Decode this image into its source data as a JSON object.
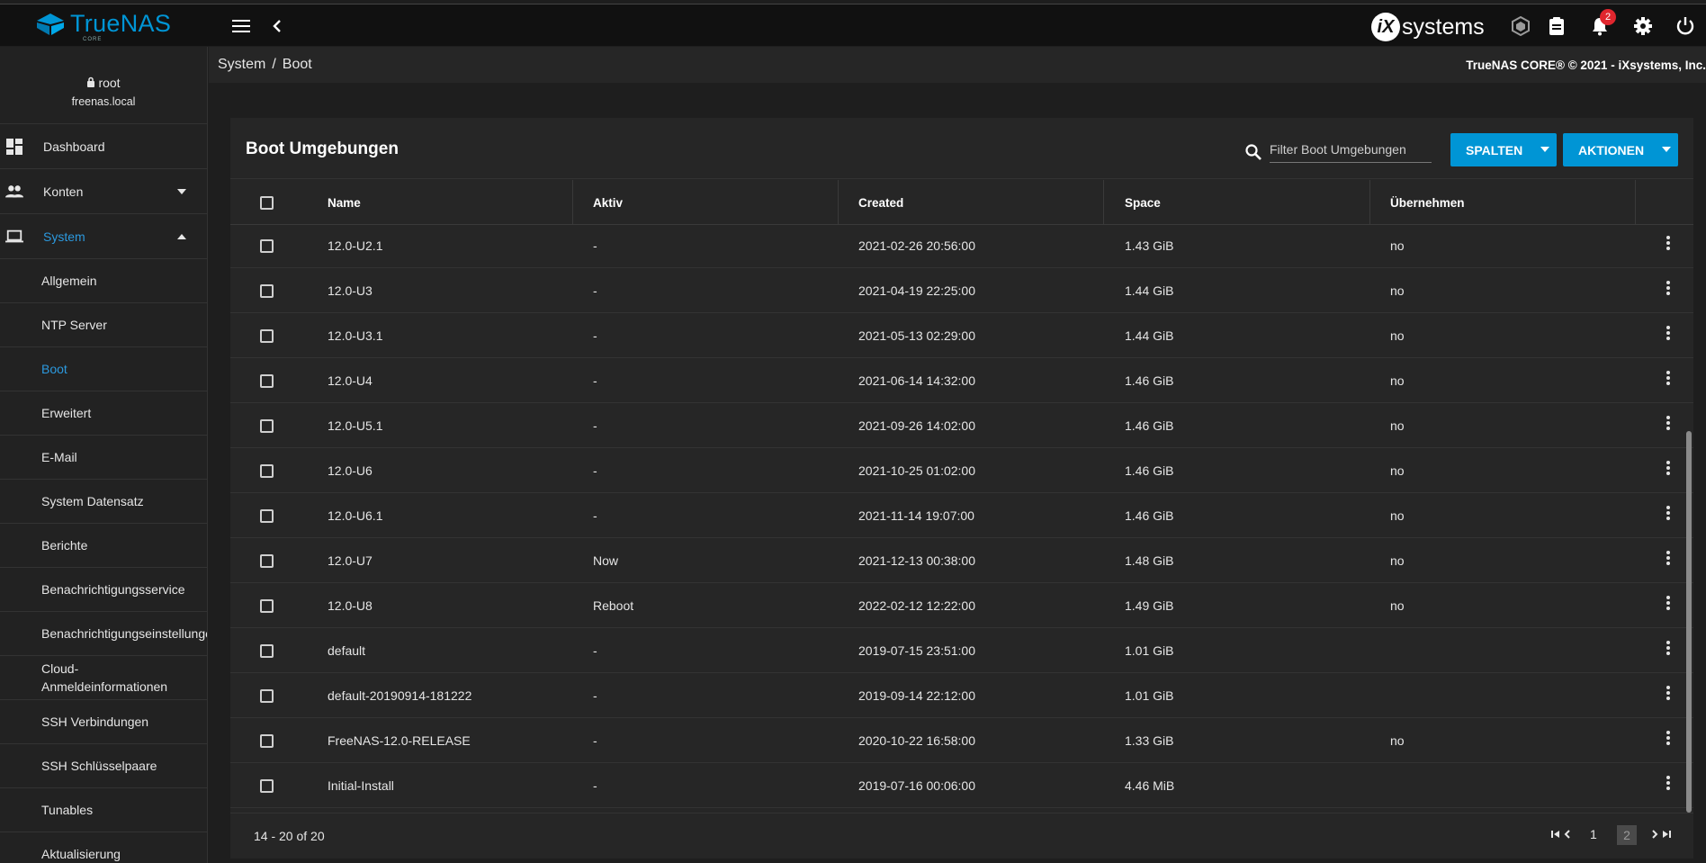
{
  "topbar": {
    "logo_text": "TrueNAS",
    "logo_sub": "CORE",
    "brand_mark": "iX",
    "brand_text": "systems",
    "notification_count": "2",
    "icons": [
      "menu-icon",
      "chevron-left-icon",
      "truecommand-icon",
      "clipboard-icon",
      "bell-icon",
      "gear-icon",
      "power-icon"
    ]
  },
  "sidebar": {
    "user": "root",
    "host": "freenas.local",
    "nav": [
      {
        "label": "Dashboard",
        "icon": "dashboard-icon"
      },
      {
        "label": "Konten",
        "icon": "people-icon"
      },
      {
        "label": "System",
        "icon": "laptop-icon"
      }
    ],
    "sub_items": [
      "Allgemein",
      "NTP Server",
      "Boot",
      "Erweitert",
      "E-Mail",
      "System Datensatz",
      "Berichte",
      "Benachrichtigungsservice",
      "Benachrichtigungseinstellungen",
      "Cloud-Anmeldeinformationen",
      "SSH Verbindungen",
      "SSH Schlüsselpaare",
      "Tunables",
      "Aktualisierung"
    ]
  },
  "breadcrumb": {
    "parent": "System",
    "separator": "/",
    "current": "Boot"
  },
  "copyright": "TrueNAS CORE® © 2021 - iXsystems, Inc.",
  "card": {
    "title": "Boot Umgebungen",
    "filter_placeholder": "Filter Boot Umgebungen",
    "columns_button": "SPALTEN",
    "actions_button": "AKTIONEN"
  },
  "table": {
    "headers": [
      "Name",
      "Aktiv",
      "Created",
      "Space",
      "Übernehmen"
    ],
    "rows": [
      {
        "name": "12.0-U2.1",
        "aktiv": "-",
        "created": "2021-02-26 20:56:00",
        "space": "1.43 GiB",
        "uebernehmen": "no"
      },
      {
        "name": "12.0-U3",
        "aktiv": "-",
        "created": "2021-04-19 22:25:00",
        "space": "1.44 GiB",
        "uebernehmen": "no"
      },
      {
        "name": "12.0-U3.1",
        "aktiv": "-",
        "created": "2021-05-13 02:29:00",
        "space": "1.44 GiB",
        "uebernehmen": "no"
      },
      {
        "name": "12.0-U4",
        "aktiv": "-",
        "created": "2021-06-14 14:32:00",
        "space": "1.46 GiB",
        "uebernehmen": "no"
      },
      {
        "name": "12.0-U5.1",
        "aktiv": "-",
        "created": "2021-09-26 14:02:00",
        "space": "1.46 GiB",
        "uebernehmen": "no"
      },
      {
        "name": "12.0-U6",
        "aktiv": "-",
        "created": "2021-10-25 01:02:00",
        "space": "1.46 GiB",
        "uebernehmen": "no"
      },
      {
        "name": "12.0-U6.1",
        "aktiv": "-",
        "created": "2021-11-14 19:07:00",
        "space": "1.46 GiB",
        "uebernehmen": "no"
      },
      {
        "name": "12.0-U7",
        "aktiv": "Now",
        "created": "2021-12-13 00:38:00",
        "space": "1.48 GiB",
        "uebernehmen": "no"
      },
      {
        "name": "12.0-U8",
        "aktiv": "Reboot",
        "created": "2022-02-12 12:22:00",
        "space": "1.49 GiB",
        "uebernehmen": "no"
      },
      {
        "name": "default",
        "aktiv": "-",
        "created": "2019-07-15 23:51:00",
        "space": "1.01 GiB",
        "uebernehmen": ""
      },
      {
        "name": "default-20190914-181222",
        "aktiv": "-",
        "created": "2019-09-14 22:12:00",
        "space": "1.01 GiB",
        "uebernehmen": ""
      },
      {
        "name": "FreeNAS-12.0-RELEASE",
        "aktiv": "-",
        "created": "2020-10-22 16:58:00",
        "space": "1.33 GiB",
        "uebernehmen": "no"
      },
      {
        "name": "Initial-Install",
        "aktiv": "-",
        "created": "2019-07-16 00:06:00",
        "space": "4.46 MiB",
        "uebernehmen": ""
      }
    ]
  },
  "pagination": {
    "range": "14 - 20 of 20",
    "page_1": "1",
    "page_2": "2"
  },
  "colors": {
    "accent": "#0095d5",
    "active_link": "#2c99de",
    "badge": "#e0262e",
    "background": "#1e1e1e",
    "card": "#262626"
  }
}
